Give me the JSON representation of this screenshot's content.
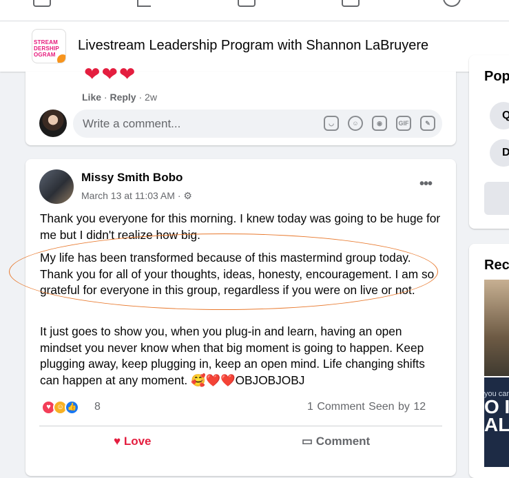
{
  "group": {
    "logo_text": "STREAM\nDERSHIP\nOGRAM",
    "title": "Livestream Leadership Program with Shannon LaBruyere"
  },
  "prev_comment": {
    "hearts": "❤❤❤",
    "like": "Like",
    "reply": "Reply",
    "age": "2w",
    "placeholder": "Write a comment...",
    "icons": [
      "sticker-icon",
      "emoji-icon",
      "camera-icon",
      "gif-icon",
      "avatar-sticker-icon"
    ]
  },
  "post": {
    "author": "Missy Smith Bobo",
    "date": "March 13 at 11:03 AM · ",
    "privacy_icon": "group-privacy-icon",
    "paragraphs": [
      "Thank you everyone for this morning. I knew today was going to be huge for me but I didn't realize how big.",
      "My life has been transformed because of this mastermind group today. Thank you for all of your thoughts, ideas, honesty, encouragement. I am so grateful for everyone in this group, regardless if you were on live or not.",
      "It just goes to show you, when you plug-in and learn, having an open mindset you never know when that big moment is going to happen. Keep plugging away, keep plugging in, keep an open mind. Life changing shifts can happen at any moment. 🥰❤️❤️OBJOBJOBJ"
    ],
    "reaction_count": "8",
    "comments": "1 Comment",
    "seen": "Seen by 12",
    "love_label": "Love",
    "comment_label": "Comment",
    "annotation_color": "#e8782c"
  },
  "sidebar": {
    "popular_heading": "Pop",
    "chips": [
      "Q",
      "D"
    ],
    "recent_heading": "Rec",
    "promo_text_a": "you can",
    "promo_text_b": "O I\nALL"
  }
}
